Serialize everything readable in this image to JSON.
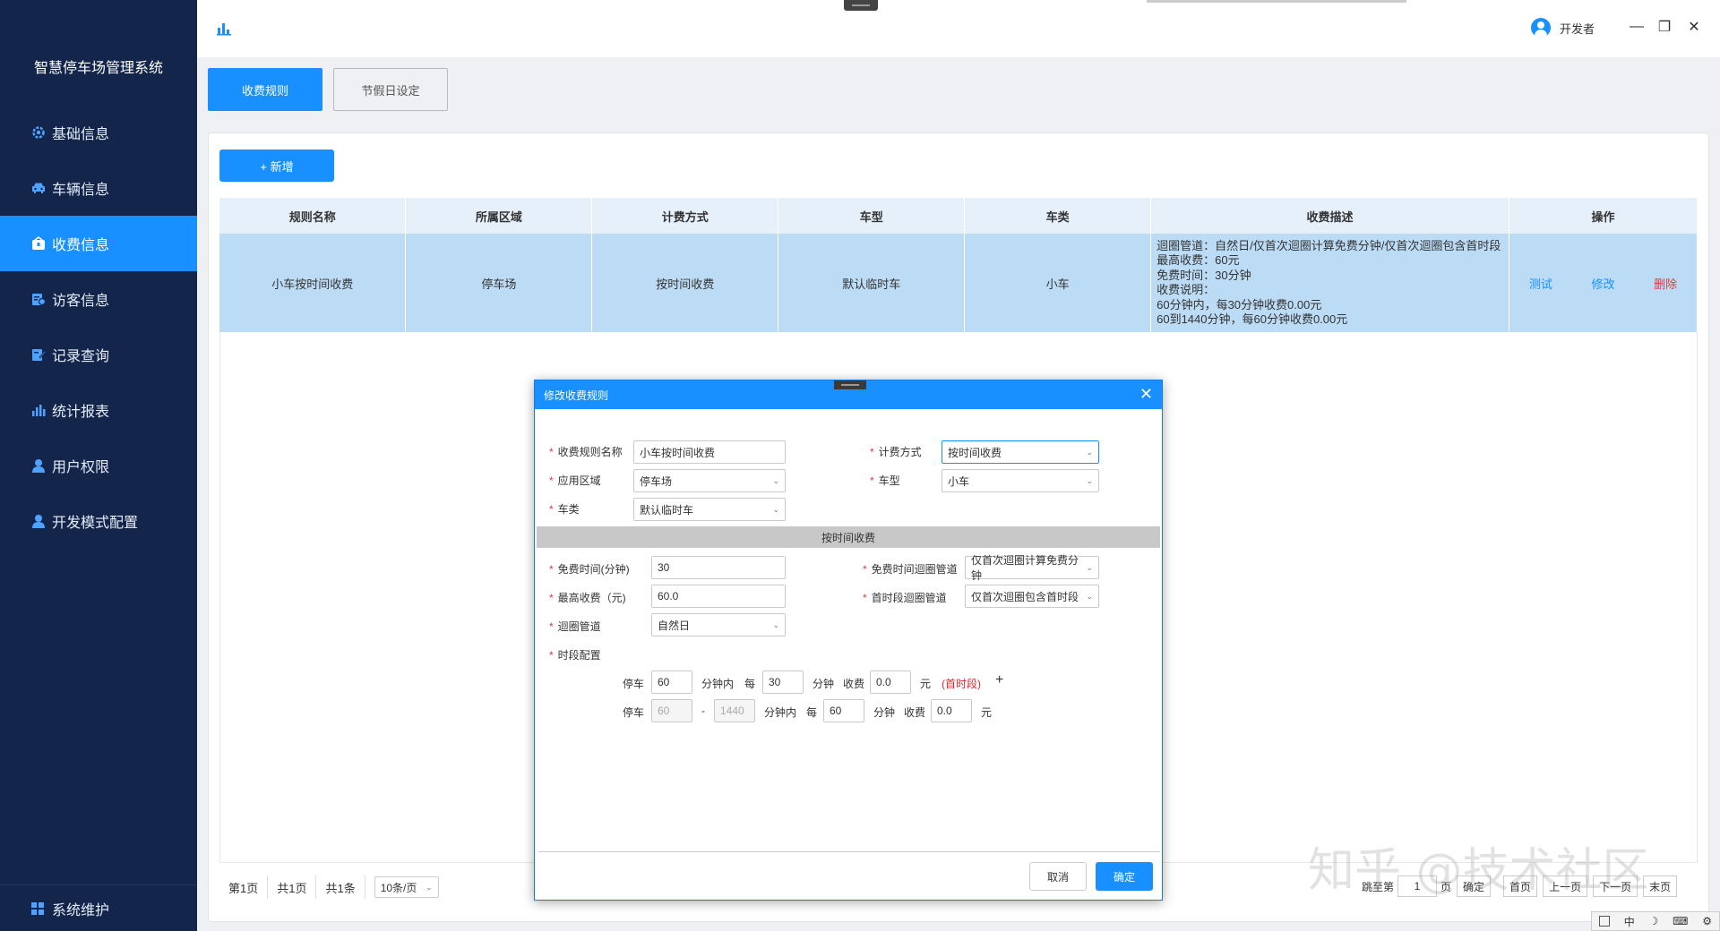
{
  "app": {
    "title": "智慧停车场管理系统"
  },
  "sidebar": {
    "items": [
      {
        "label": "基础信息",
        "icon": "gear-icon"
      },
      {
        "label": "车辆信息",
        "icon": "car-icon"
      },
      {
        "label": "收费信息",
        "icon": "wallet-icon",
        "active": true
      },
      {
        "label": "访客信息",
        "icon": "visitor-icon"
      },
      {
        "label": "记录查询",
        "icon": "edit-icon"
      },
      {
        "label": "统计报表",
        "icon": "bar-chart-icon"
      },
      {
        "label": "用户权限",
        "icon": "user-icon"
      },
      {
        "label": "开发模式配置",
        "icon": "user-icon"
      }
    ],
    "bottom": {
      "label": "系统维护",
      "icon": "grid-icon"
    }
  },
  "topbar": {
    "user_name": "开发者",
    "minimize": "—",
    "restore": "❐",
    "close": "✕"
  },
  "tabs": [
    {
      "label": "收费规则",
      "active": true
    },
    {
      "label": "节假日设定",
      "active": false
    }
  ],
  "toolbar": {
    "add_label": "+ 新增"
  },
  "table": {
    "headers": [
      "规则名称",
      "所属区域",
      "计费方式",
      "车型",
      "车类",
      "收费描述",
      "操作"
    ],
    "rows": [
      {
        "name": "小车按时间收费",
        "area": "停车场",
        "billing": "按时间收费",
        "car_model": "默认临时车",
        "car_class": "小车",
        "desc": [
          "迴圈管道：自然日/仅首次迴圈计算免费分钟/仅首次迴圈包含首时段",
          "最高收费：60元",
          "免费时间：30分钟",
          "收费说明：",
          "60分钟内，每30分钟收费0.00元",
          "60到1440分钟，每60分钟收费0.00元"
        ],
        "ops": {
          "test": "测试",
          "edit": "修改",
          "delete": "删除"
        }
      }
    ]
  },
  "pager": {
    "current": "第1页",
    "total_pages": "共1页",
    "total_items": "共1条",
    "page_size": "10条/页",
    "jump_label": "跳至第",
    "jump_value": "1",
    "page_unit": "页",
    "confirm": "确定",
    "first": "首页",
    "prev": "上一页",
    "next": "下一页",
    "last": "末页"
  },
  "watermark": "知乎 @技术社区",
  "tray": [
    "中",
    "☽",
    "⌨",
    "⚙"
  ],
  "modal": {
    "title": "修改收费规则",
    "close": "✕",
    "fields": {
      "rule_name_label": "收费规则名称",
      "rule_name_value": "小车按时间收费",
      "billing_label": "计费方式",
      "billing_value": "按时间收费",
      "area_label": "应用区域",
      "area_value": "停车场",
      "car_model_label": "车型",
      "car_model_value": "小车",
      "car_class_label": "车类",
      "car_class_value": "默认临时车"
    },
    "section_title": "按时间收费",
    "time": {
      "free_time_label": "免费时间(分钟)",
      "free_time_value": "30",
      "free_loop_label": "免费时间迴圈管道",
      "free_loop_value": "仅首次迴圈计算免费分钟",
      "max_fee_label": "最高收费（元)",
      "max_fee_value": "60.0",
      "first_loop_label": "首时段迴圈管道",
      "first_loop_value": "仅首次迴圈包含首时段",
      "loop_label": "迴圈管道",
      "loop_value": "自然日",
      "period_label": "时段配置"
    },
    "period1": {
      "park": "停车",
      "min_value": "60",
      "within": "分钟内",
      "every": "每",
      "every_value": "30",
      "minute": "分钟",
      "charge": "收费",
      "fee_value": "0.0",
      "yuan": "元",
      "first_tag": "(首时段)",
      "plus": "+"
    },
    "period2": {
      "park": "停车",
      "from_value": "60",
      "dash": "-",
      "to_value": "1440",
      "within": "分钟内",
      "every": "每",
      "every_value": "60",
      "minute": "分钟",
      "charge": "收费",
      "fee_value": "0.0",
      "yuan": "元"
    },
    "cancel": "取消",
    "ok": "确定"
  }
}
